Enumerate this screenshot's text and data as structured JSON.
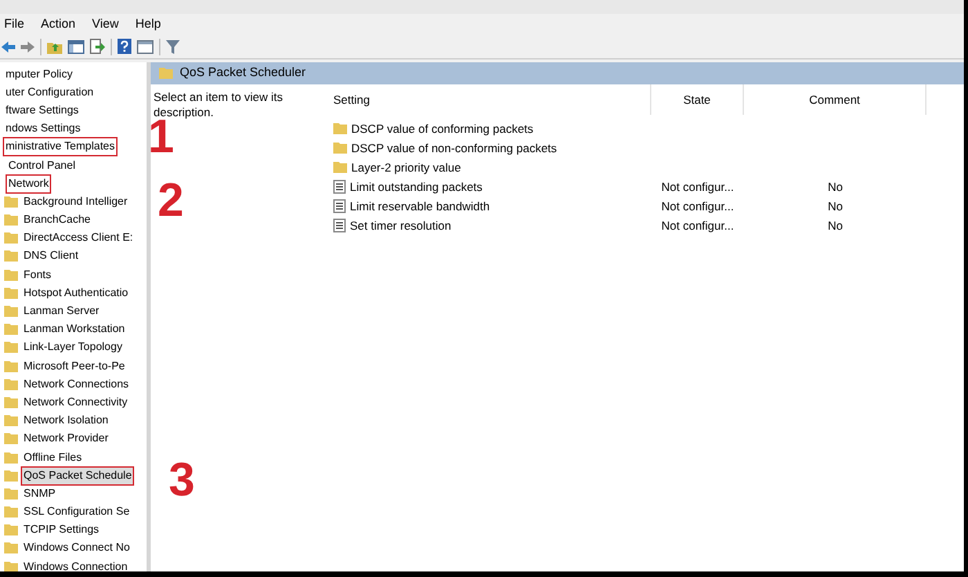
{
  "menu": [
    "File",
    "Action",
    "View",
    "Help"
  ],
  "tree": [
    {
      "label": "mputer Policy",
      "boxed": false,
      "selected": false
    },
    {
      "label": "uter Configuration",
      "boxed": false,
      "selected": false,
      "children": [
        {
          "label": "ftware Settings",
          "boxed": false,
          "selected": false
        },
        {
          "label": "ndows Settings",
          "boxed": false,
          "selected": false
        },
        {
          "label": "ministrative Templates",
          "boxed": true,
          "selected": false,
          "children": [
            {
              "label": "Control Panel",
              "boxed": false,
              "selected": false
            },
            {
              "label": "Network",
              "boxed": true,
              "selected": false,
              "children": [
                {
                  "label": "Background Intelliger",
                  "boxed": false,
                  "selected": false
                },
                {
                  "label": "BranchCache",
                  "boxed": false,
                  "selected": false
                },
                {
                  "label": "DirectAccess Client E:",
                  "boxed": false,
                  "selected": false
                },
                {
                  "label": "DNS Client",
                  "boxed": false,
                  "selected": false
                },
                {
                  "label": "Fonts",
                  "boxed": false,
                  "selected": false
                },
                {
                  "label": "Hotspot Authenticatio",
                  "boxed": false,
                  "selected": false
                },
                {
                  "label": "Lanman Server",
                  "boxed": false,
                  "selected": false
                },
                {
                  "label": "Lanman Workstation",
                  "boxed": false,
                  "selected": false
                },
                {
                  "label": "Link-Layer Topology",
                  "boxed": false,
                  "selected": false
                },
                {
                  "label": "Microsoft Peer-to-Pe",
                  "boxed": false,
                  "selected": false
                },
                {
                  "label": "Network Connections",
                  "boxed": false,
                  "selected": false
                },
                {
                  "label": "Network Connectivity",
                  "boxed": false,
                  "selected": false
                },
                {
                  "label": "Network Isolation",
                  "boxed": false,
                  "selected": false
                },
                {
                  "label": "Network Provider",
                  "boxed": false,
                  "selected": false
                },
                {
                  "label": "Offline Files",
                  "boxed": false,
                  "selected": false
                },
                {
                  "label": "QoS Packet Schedule",
                  "boxed": true,
                  "selected": true
                },
                {
                  "label": "SNMP",
                  "boxed": false,
                  "selected": false
                },
                {
                  "label": "SSL Configuration Se",
                  "boxed": false,
                  "selected": false
                },
                {
                  "label": "TCPIP Settings",
                  "boxed": false,
                  "selected": false
                },
                {
                  "label": "Windows Connect No",
                  "boxed": false,
                  "selected": false
                },
                {
                  "label": "Windows Connection",
                  "boxed": false,
                  "selected": false
                }
              ]
            }
          ]
        }
      ]
    }
  ],
  "pane_title": "QoS Packet Scheduler",
  "description": "Select an item to view its description.",
  "table": {
    "columns": [
      "Setting",
      "State",
      "Comment"
    ],
    "rows": [
      {
        "kind": "folder",
        "setting": "DSCP value of conforming packets"
      },
      {
        "kind": "folder",
        "setting": "DSCP value of non-conforming packets"
      },
      {
        "kind": "folder",
        "setting": "Layer-2 priority value"
      },
      {
        "kind": "policy",
        "setting": "Limit outstanding packets",
        "state": "Not configur...",
        "comment": "No"
      },
      {
        "kind": "policy",
        "setting": "Limit reservable bandwidth",
        "state": "Not configur...",
        "comment": "No"
      },
      {
        "kind": "policy",
        "setting": "Set timer resolution",
        "state": "Not configur...",
        "comment": "No"
      }
    ]
  },
  "annotations": [
    "1",
    "2",
    "3"
  ]
}
